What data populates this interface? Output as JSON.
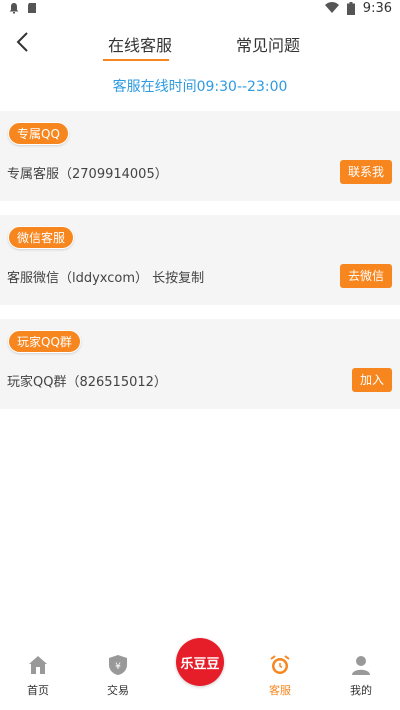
{
  "status_bar": {
    "time": "9:36"
  },
  "header": {
    "tabs": [
      {
        "label": "在线客服",
        "active": true
      },
      {
        "label": "常见问题",
        "active": false
      }
    ]
  },
  "service_hours": "客服在线时间09:30--23:00",
  "cards": [
    {
      "badge": "专属QQ",
      "description": "专属客服（2709914005）",
      "action": "联系我"
    },
    {
      "badge": "微信客服",
      "description": "客服微信（lddyxcom） 长按复制",
      "action": "去微信"
    },
    {
      "badge": "玩家QQ群",
      "description": "玩家QQ群（826515012）",
      "action": "加入"
    }
  ],
  "bottom_nav": {
    "items": [
      {
        "label": "首页",
        "icon": "home-icon"
      },
      {
        "label": "交易",
        "icon": "shield-yen-icon"
      },
      {
        "label": "客服",
        "icon": "alarm-clock-icon",
        "active": true
      },
      {
        "label": "我的",
        "icon": "person-icon"
      }
    ],
    "center_logo": "乐豆豆"
  },
  "colors": {
    "accent": "#f7861e",
    "link_blue": "#2f9be0",
    "logo_red": "#e51e2a"
  }
}
